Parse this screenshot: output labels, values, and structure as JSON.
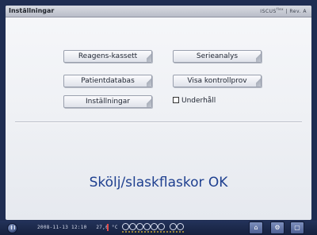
{
  "window": {
    "title": "Inställningar",
    "brand": "ISCUS",
    "brand_sup": "flex",
    "brand_rev": "| Rev. A"
  },
  "buttons": {
    "reagent_cassette": "Reagens-kassett",
    "serial_analysis": "Serieanalys",
    "patient_database": "Patientdatabas",
    "show_control_sample": "Visa kontrollprov",
    "settings": "Inställningar"
  },
  "maintenance": {
    "label": "Underhåll",
    "checked": false
  },
  "message": "Skölj/slaskflaskor OK",
  "taskbar": {
    "datetime": "2008-11-13 12:10",
    "temperature": "27,6 °C"
  },
  "colors": {
    "message": "#1e3f8f",
    "bezel": "#1f2d52",
    "thermometer": "#e04848"
  }
}
